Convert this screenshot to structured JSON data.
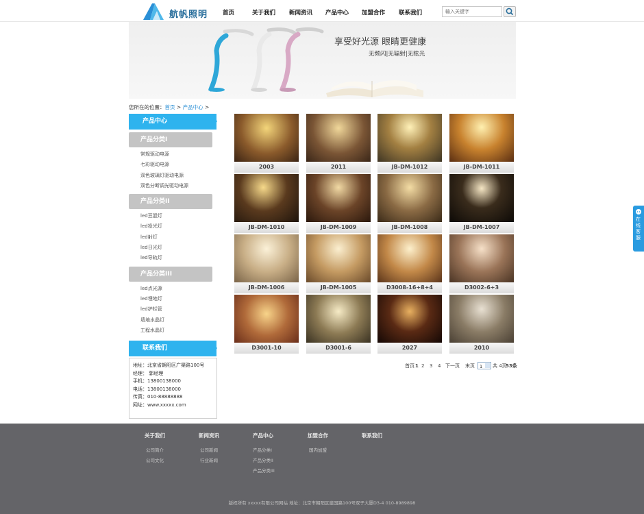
{
  "brand": {
    "name": "航帆照明"
  },
  "nav": [
    "首页",
    "关于我们",
    "新闻资讯",
    "产品中心",
    "加盟合作",
    "联系我们"
  ],
  "search": {
    "placeholder": "输入关键字"
  },
  "banner": {
    "headline": "享受好光源 眼睛更健康",
    "sub": "无频闪|无辐射|无眩光"
  },
  "breadcrumb": {
    "prefix": "您所在的位置：",
    "home": "首页",
    "sep": ">",
    "current": "产品中心"
  },
  "sidebar": {
    "title": "产品中心",
    "categories": [
      {
        "name": "产品分类I",
        "items": [
          "常规驱动电源",
          "七彩驱动电源",
          "双色玻璃灯驱动电源",
          "双色分断调光驱动电源"
        ]
      },
      {
        "name": "产品分类II",
        "items": [
          "led豆胆灯",
          "led投光灯",
          "led射灯",
          "led日光灯",
          "led导轨灯"
        ]
      },
      {
        "name": "产品分类III",
        "items": [
          "led点光源",
          "led埋地灯",
          "led护栏管",
          "墙地水晶灯",
          "工程水晶灯"
        ]
      }
    ],
    "contact_title": "联系我们",
    "contact_lines": [
      "地址：北京省朝阳区广渠路100号",
      "经理： 郭经理",
      "手机：13800138000",
      "电话：13800138000",
      "传真：010-88888888",
      "网址：www.xxxxx.com"
    ]
  },
  "products": [
    "2003",
    "2011",
    "JB-DM-1012",
    "JB-DM-1011",
    "JB-DM-1010",
    "JB-DM-1009",
    "JB-DM-1008",
    "JB-DM-1007",
    "JB-DM-1006",
    "JB-DM-1005",
    "D3008-16+8+4",
    "D3002-6+3",
    "D3001-10",
    "D3001-6",
    "2027",
    "2010"
  ],
  "pagination": {
    "first": "首页",
    "current": "1",
    "pages": [
      "2",
      "3",
      "4"
    ],
    "next": "下一页",
    "last": "末页",
    "select_value": "1",
    "total_pages": "共 4页",
    "total_items": "53条"
  },
  "float_service": {
    "label": "在线客服"
  },
  "footer": {
    "columns": [
      {
        "title": "关于我们",
        "links": [
          "公司简介",
          "公司文化"
        ]
      },
      {
        "title": "新闻资讯",
        "links": [
          "公司新闻",
          "行业新闻"
        ]
      },
      {
        "title": "产品中心",
        "links": [
          "产品分类I",
          "产品分类II",
          "产品分类III"
        ]
      },
      {
        "title": "加盟合作",
        "links": [
          "国内加盟"
        ]
      },
      {
        "title": "联系我们",
        "links": []
      }
    ],
    "copyright": "版权所有 xxxxx有限公司网站 地址：北京市朝阳区建国路100号双子大厦D3-4 010-8989898"
  },
  "colors": {
    "accent": "#2eb3ee",
    "category": "#c4c4c4",
    "footer": "#646468",
    "link": "#2a8fd6"
  }
}
